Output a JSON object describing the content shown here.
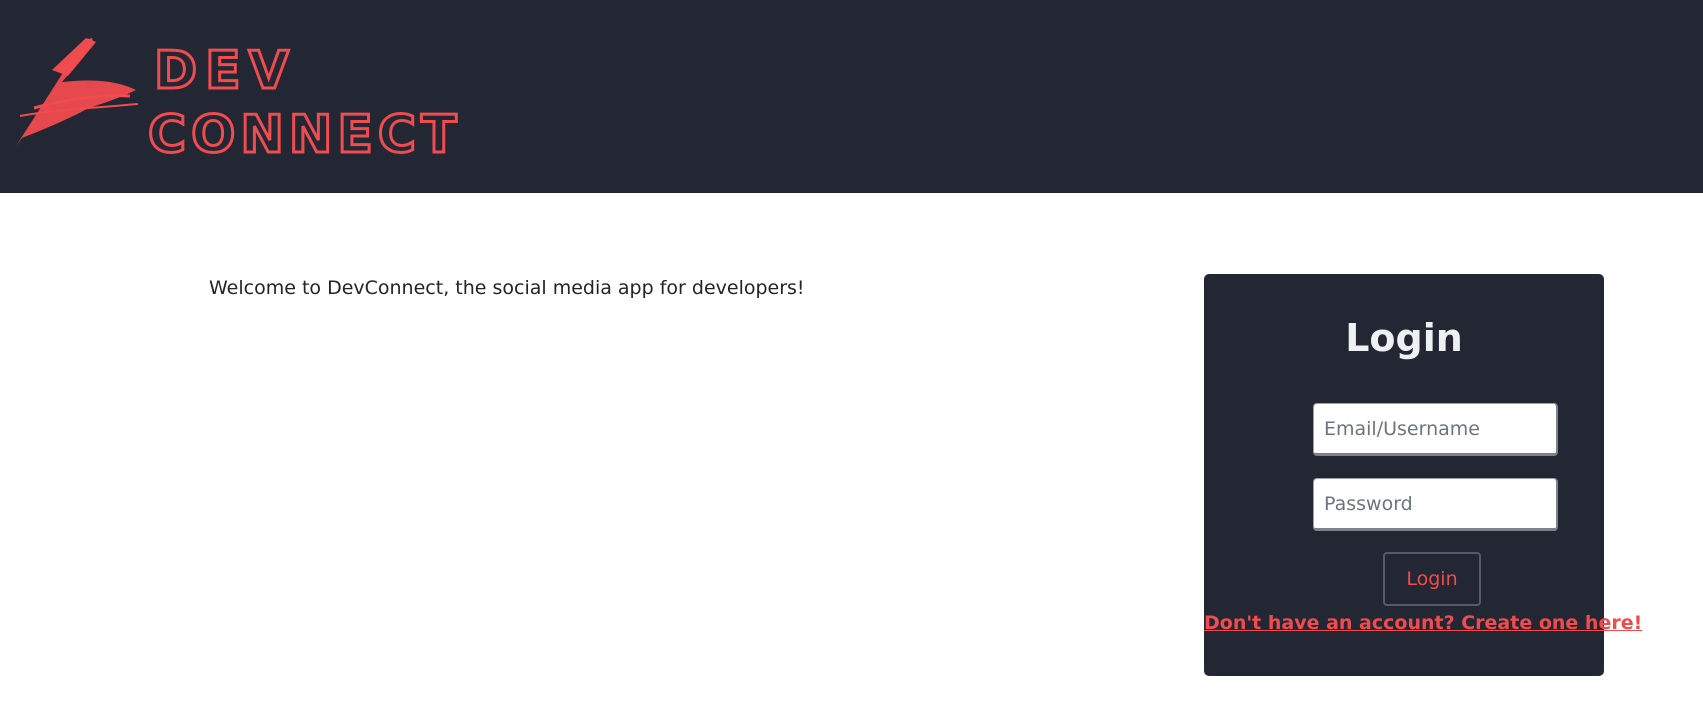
{
  "header": {
    "logo": {
      "line1": "DEV",
      "line2": "CONNECT",
      "color": "#f04b4f",
      "icon": "pen-logo-icon"
    },
    "background": "#222733"
  },
  "main": {
    "welcome_text": "Welcome to DevConnect, the social media app for developers!"
  },
  "login": {
    "title": "Login",
    "email_placeholder": "Email/Username",
    "email_value": "",
    "password_placeholder": "Password",
    "password_value": "",
    "submit_label": "Login",
    "signup_link": "Don't have an account? Create one here!",
    "accent": "#f04b4f"
  }
}
